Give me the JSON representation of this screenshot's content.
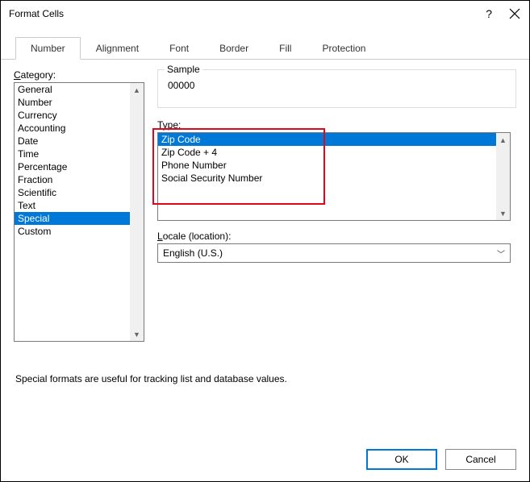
{
  "window": {
    "title": "Format Cells"
  },
  "tabs": {
    "t0": "Number",
    "t1": "Alignment",
    "t2": "Font",
    "t3": "Border",
    "t4": "Fill",
    "t5": "Protection"
  },
  "category": {
    "label_pre": "C",
    "label_post": "ategory:",
    "items": {
      "i0": "General",
      "i1": "Number",
      "i2": "Currency",
      "i3": "Accounting",
      "i4": "Date",
      "i5": "Time",
      "i6": "Percentage",
      "i7": "Fraction",
      "i8": "Scientific",
      "i9": "Text",
      "i10": "Special",
      "i11": "Custom"
    }
  },
  "sample": {
    "label": "Sample",
    "value": "00000"
  },
  "type": {
    "label_pre": "T",
    "label_post": "ype:",
    "items": {
      "t0": "Zip Code",
      "t1": "Zip Code + 4",
      "t2": "Phone Number",
      "t3": "Social Security Number"
    }
  },
  "locale": {
    "label_pre": "L",
    "label_post": "ocale (location):",
    "value": "English (U.S.)"
  },
  "helptext": "Special formats are useful for tracking list and database values.",
  "buttons": {
    "ok": "OK",
    "cancel": "Cancel"
  }
}
